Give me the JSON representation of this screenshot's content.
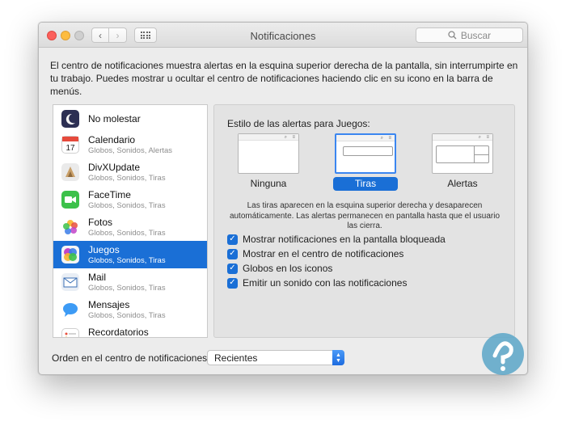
{
  "window": {
    "title": "Notificaciones",
    "search_placeholder": "Buscar"
  },
  "intro": "El centro de notificaciones muestra alertas en la esquina superior derecha de la pantalla, sin interrumpirte en tu trabajo. Puedes mostrar u ocultar el centro de notificaciones haciendo clic en su icono en la barra de menús.",
  "apps": [
    {
      "name": "No molestar",
      "sub": "",
      "icon": "moon-icon"
    },
    {
      "name": "Calendario",
      "sub": "Globos, Sonidos, Alertas",
      "icon": "calendar-icon"
    },
    {
      "name": "DivXUpdate",
      "sub": "Globos, Sonidos, Tiras",
      "icon": "divx-icon"
    },
    {
      "name": "FaceTime",
      "sub": "Globos, Sonidos, Tiras",
      "icon": "facetime-icon"
    },
    {
      "name": "Fotos",
      "sub": "Globos, Sonidos, Tiras",
      "icon": "photos-icon"
    },
    {
      "name": "Juegos",
      "sub": "Globos, Sonidos, Tiras",
      "icon": "game-center-icon",
      "selected": true
    },
    {
      "name": "Mail",
      "sub": "Globos, Sonidos, Tiras",
      "icon": "mail-icon"
    },
    {
      "name": "Mensajes",
      "sub": "Globos, Sonidos, Tiras",
      "icon": "messages-icon"
    },
    {
      "name": "Recordatorios",
      "sub": "",
      "icon": "reminders-icon"
    }
  ],
  "panel": {
    "heading": "Estilo de las alertas para Juegos:",
    "styles": [
      "Ninguna",
      "Tiras",
      "Alertas"
    ],
    "selected_style": "Tiras",
    "description": "Las tiras aparecen en la esquina superior derecha y desaparecen automáticamente. Las alertas permanecen en pantalla hasta que el usuario las cierra.",
    "options": [
      {
        "label": "Mostrar notificaciones en la pantalla bloqueada",
        "checked": true
      },
      {
        "label": "Mostrar en el centro de notificaciones",
        "checked": true
      },
      {
        "label": "Globos en los iconos",
        "checked": true
      },
      {
        "label": "Emitir un sonido con las notificaciones",
        "checked": true
      }
    ]
  },
  "sort": {
    "label": "Orden en el centro de notificaciones:",
    "value": "Recientes"
  },
  "colors": {
    "accent": "#1a6fd6",
    "close": "#fc605c",
    "minimize": "#fdbc40",
    "watermark": "#5aa6c8"
  }
}
